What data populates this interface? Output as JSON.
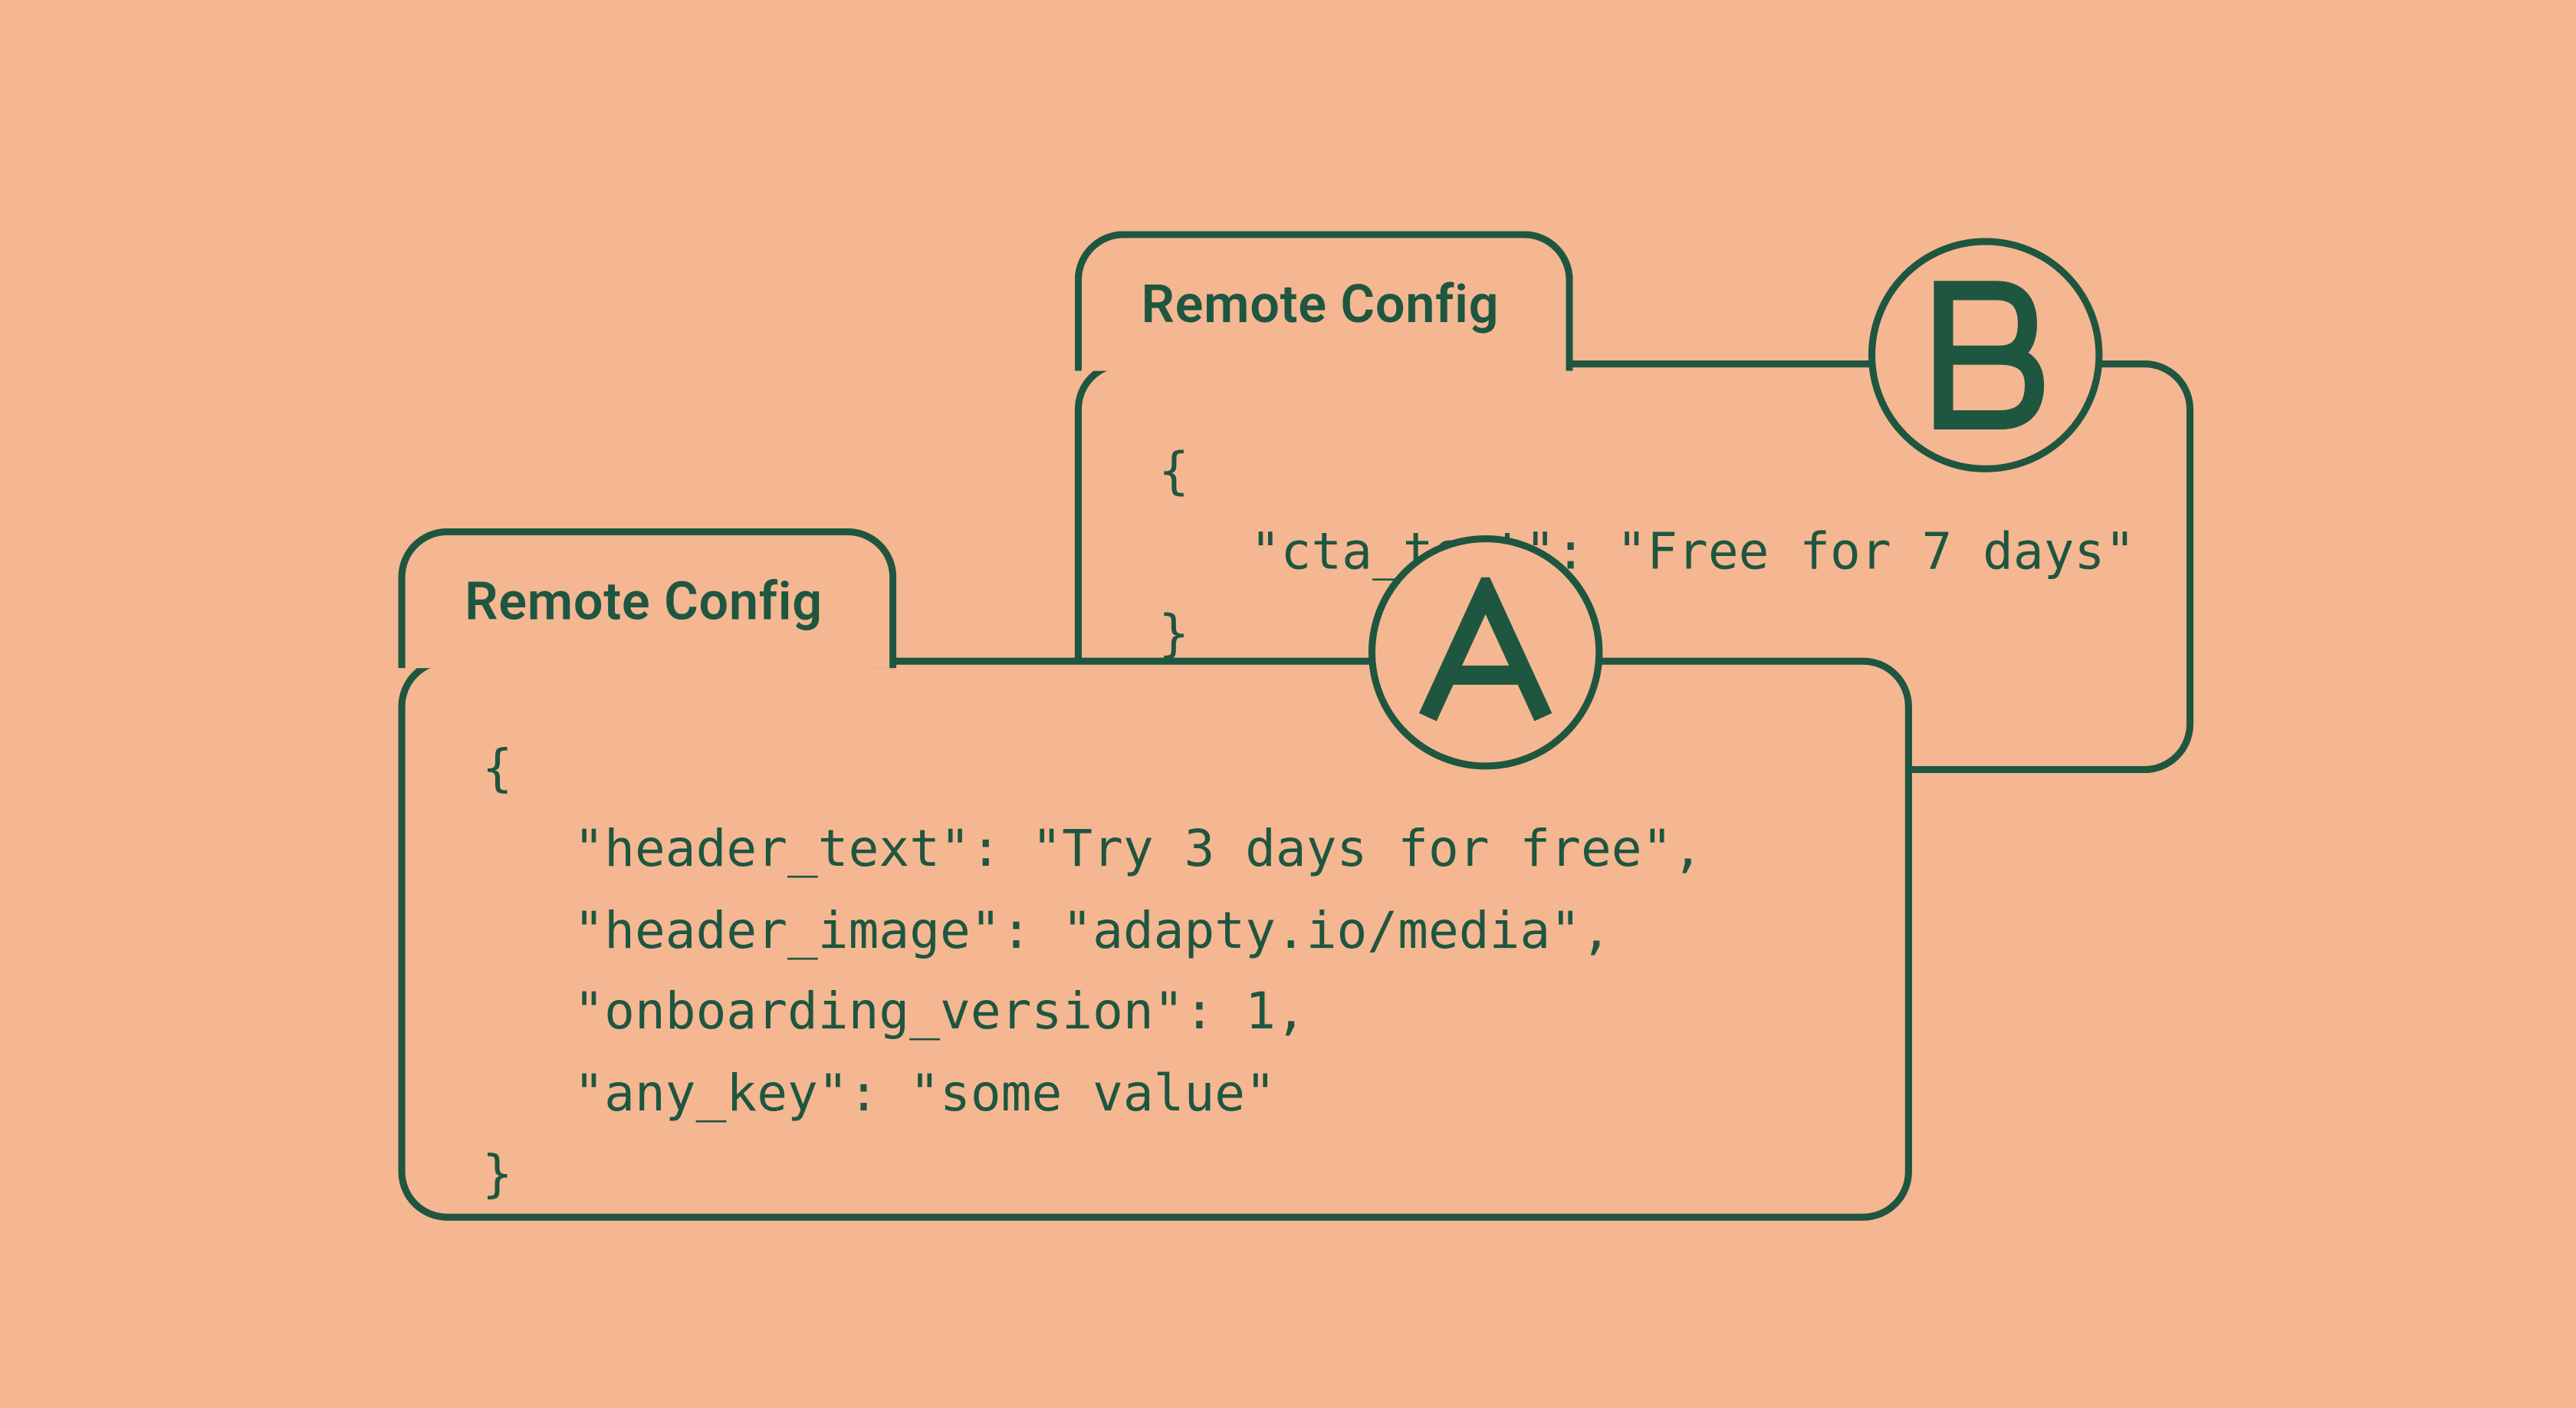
{
  "colors": {
    "background": "#f4b792",
    "stroke": "#1e5640"
  },
  "cards": {
    "b": {
      "title": "Remote Config",
      "badge": "B",
      "code": "{\n   \"cta_text\": \"Free for 7 days\"\n}"
    },
    "a": {
      "title": "Remote Config",
      "badge": "A",
      "code": "{\n   \"header_text\": \"Try 3 days for free\",\n   \"header_image\": \"adapty.io/media\",\n   \"onboarding_version\": 1,\n   \"any_key\": \"some value\"\n}"
    }
  }
}
